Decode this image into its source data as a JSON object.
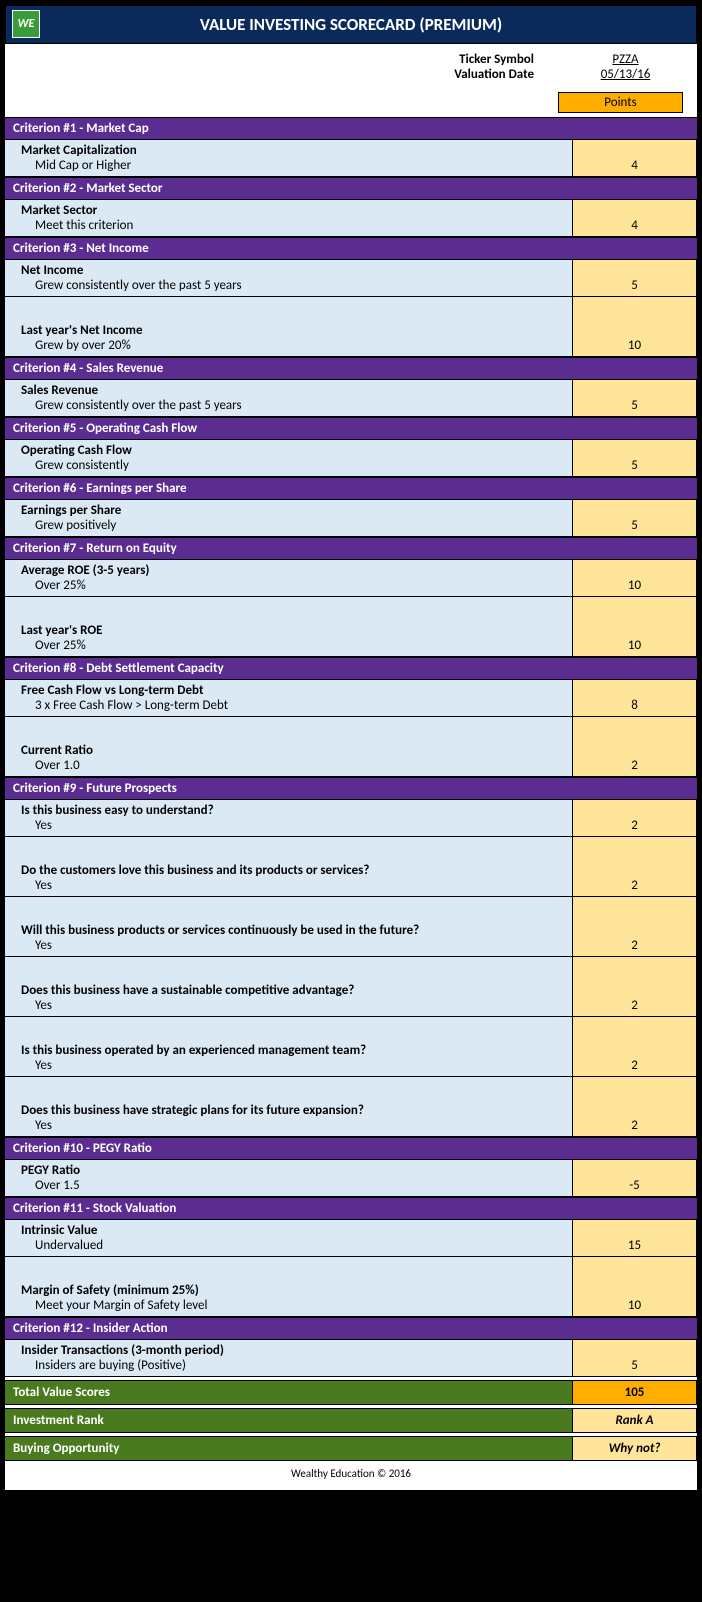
{
  "header": {
    "title": "VALUE INVESTING SCORECARD (PREMIUM)",
    "logo_text": "WE"
  },
  "meta": {
    "ticker_label": "Ticker Symbol",
    "ticker_value": "PZZA",
    "date_label": "Valuation Date",
    "date_value": "05/13/16",
    "points_header": "Points"
  },
  "criteria": [
    {
      "header": "Criterion #1 - Market Cap",
      "items": [
        {
          "title": "Market Capitalization",
          "sub": "Mid Cap or Higher",
          "points": "4"
        }
      ]
    },
    {
      "header": "Criterion #2 - Market Sector",
      "items": [
        {
          "title": "Market Sector",
          "sub": "Meet this criterion",
          "points": "4"
        }
      ]
    },
    {
      "header": "Criterion #3 - Net Income",
      "items": [
        {
          "title": "Net Income",
          "sub": "Grew consistently over the past 5 years",
          "points": "5"
        },
        {
          "title": "Last year's Net Income",
          "sub": "Grew by over 20%",
          "points": "10"
        }
      ]
    },
    {
      "header": "Criterion #4 - Sales Revenue",
      "items": [
        {
          "title": "Sales Revenue",
          "sub": "Grew consistently over the past 5 years",
          "points": "5"
        }
      ]
    },
    {
      "header": "Criterion #5 - Operating Cash Flow",
      "items": [
        {
          "title": "Operating Cash Flow",
          "sub": "Grew consistently",
          "points": "5"
        }
      ]
    },
    {
      "header": "Criterion #6 - Earnings per Share",
      "items": [
        {
          "title": "Earnings per Share",
          "sub": "Grew positively",
          "points": "5"
        }
      ]
    },
    {
      "header": "Criterion #7 - Return on Equity",
      "items": [
        {
          "title": "Average ROE (3-5 years)",
          "sub": "Over 25%",
          "points": "10"
        },
        {
          "title": "Last year's ROE",
          "sub": "Over 25%",
          "points": "10"
        }
      ]
    },
    {
      "header": "Criterion #8 - Debt Settlement Capacity",
      "items": [
        {
          "title": "Free Cash Flow vs Long-term Debt",
          "sub": "3 x Free Cash Flow > Long-term Debt",
          "points": "8"
        },
        {
          "title": "Current Ratio",
          "sub": "Over 1.0",
          "points": "2"
        }
      ]
    },
    {
      "header": "Criterion #9 - Future Prospects",
      "items": [
        {
          "title": "Is this business easy to understand?",
          "sub": "Yes",
          "points": "2"
        },
        {
          "title": "Do the customers love this business and its products or services?",
          "sub": "Yes",
          "points": "2"
        },
        {
          "title": "Will this business products or services continuously be used in the future?",
          "sub": "Yes",
          "points": "2"
        },
        {
          "title": "Does this business have a sustainable competitive advantage?",
          "sub": "Yes",
          "points": "2"
        },
        {
          "title": "Is this business operated by an experienced management team?",
          "sub": "Yes",
          "points": "2"
        },
        {
          "title": "Does this business have strategic plans for its future expansion?",
          "sub": "Yes",
          "points": "2"
        }
      ]
    },
    {
      "header": "Criterion #10 - PEGY Ratio",
      "items": [
        {
          "title": "PEGY Ratio",
          "sub": "Over 1.5",
          "points": "-5"
        }
      ]
    },
    {
      "header": "Criterion #11 - Stock Valuation",
      "items": [
        {
          "title": "Intrinsic Value",
          "sub": "Undervalued",
          "points": "15"
        },
        {
          "title": "Margin of Safety (minimum 25%)",
          "sub": "Meet your Margin of Safety level",
          "points": "10"
        }
      ]
    },
    {
      "header": "Criterion #12 - Insider Action",
      "items": [
        {
          "title": "Insider Transactions (3-month period)",
          "sub": "Insiders are buying (Positive)",
          "points": "5"
        }
      ]
    }
  ],
  "totals": {
    "score_label": "Total Value Scores",
    "score_value": "105",
    "rank_label": "Investment Rank",
    "rank_value": "Rank A",
    "opp_label": "Buying Opportunity",
    "opp_value": "Why not?"
  },
  "footer": "Wealthy Education © 2016"
}
